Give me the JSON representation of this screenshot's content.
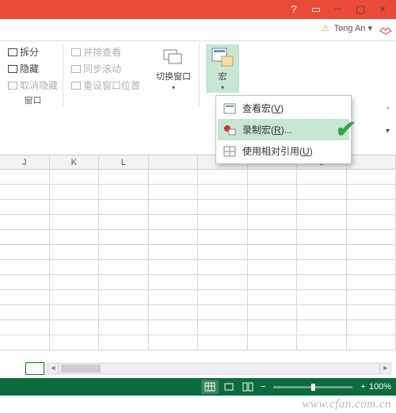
{
  "titlebar": {
    "help": "?",
    "full": "▭",
    "min": "—",
    "max": "▢",
    "close": "×"
  },
  "user": {
    "name": "Tong An",
    "dropdown": "▾"
  },
  "ribbon": {
    "window_group": {
      "split": "拆分",
      "hide": "隐藏",
      "unhide": "取消隐藏",
      "label": "窗口"
    },
    "view_group": {
      "side_by_side": "并排查看",
      "sync_scroll": "同步滚动",
      "reset_pos": "重设窗口位置"
    },
    "switch_window": {
      "label": "切换窗口",
      "arrow": "▾"
    },
    "macro": {
      "label": "宏",
      "arrow": "▾"
    }
  },
  "macro_menu": {
    "view": {
      "text": "查看宏",
      "key": "V"
    },
    "record": {
      "text": "录制宏",
      "key": "R",
      "suffix": "..."
    },
    "relative": {
      "text": "使用相对引用",
      "key": "U"
    }
  },
  "columns": [
    "J",
    "K",
    "L",
    "",
    "",
    "",
    "O",
    ""
  ],
  "statusbar": {
    "zoom_minus": "−",
    "zoom_plus": "+",
    "zoom": "100%"
  },
  "watermark": "www.cfan.com.cn"
}
